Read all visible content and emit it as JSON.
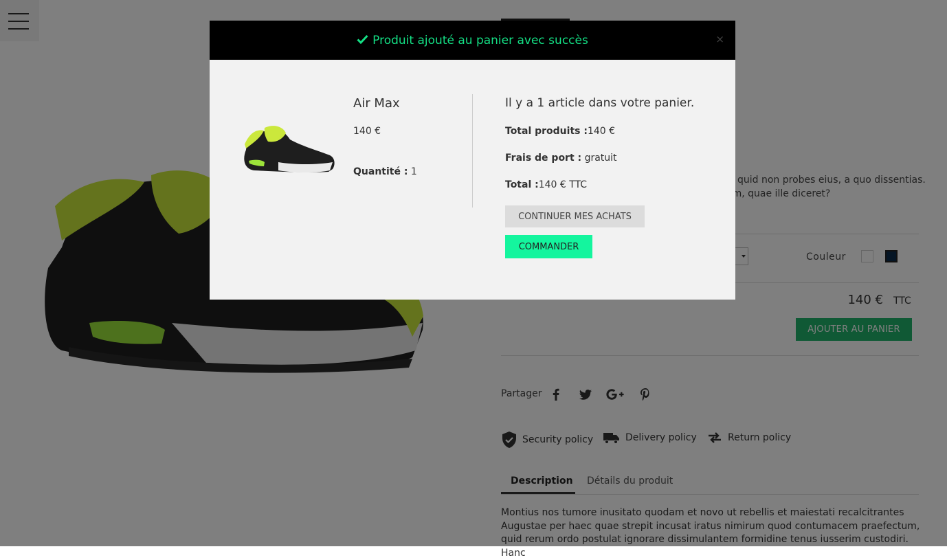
{
  "product": {
    "description_short_line1": "quid non probes eius, a quo dissentias.",
    "description_short_line2": "em, quae ille diceret?",
    "color_label": "Couleur",
    "price": "140 €",
    "tax_label": "TTC",
    "add_to_cart": "AJOUTER AU PANIER"
  },
  "share": {
    "label": "Partager",
    "icons": [
      "facebook-icon",
      "twitter-icon",
      "google-plus-icon",
      "pinterest-icon"
    ]
  },
  "policies": {
    "security": "Security policy",
    "delivery": "Delivery policy",
    "return": "Return policy"
  },
  "tabs": {
    "description": "Description",
    "details": "Détails du produit"
  },
  "description_text": "Montius nos tumore inusitato quodam et novo ut rebellis et maiestati recalcitrantes Augustae per haec quae strepit incusat iratus nimirum quod contumacem praefectum, quid rerum ordo postulat ignorare dissimulantem formidine tenus iusserim custodiri. Hanc",
  "modal": {
    "header": "Produit ajouté au panier avec succès",
    "close": "×",
    "product_name": "Air Max",
    "product_price": "140 €",
    "quantity_label": "Quantité :",
    "quantity_value": "1",
    "cart_count": "Il y a 1 article dans votre panier.",
    "total_products_label": "Total produits :",
    "total_products_value": "140 €",
    "shipping_label": "Frais de port :",
    "shipping_value": "gratuit",
    "total_label": "Total :",
    "total_value": "140 € TTC",
    "continue_button": "CONTINUER MES ACHATS",
    "order_button": "COMMANDER"
  },
  "colors": {
    "success_green": "#14e085",
    "order_button": "#14f59e",
    "add_to_cart": "#20b26b",
    "modal_header_bg": "#000000"
  }
}
